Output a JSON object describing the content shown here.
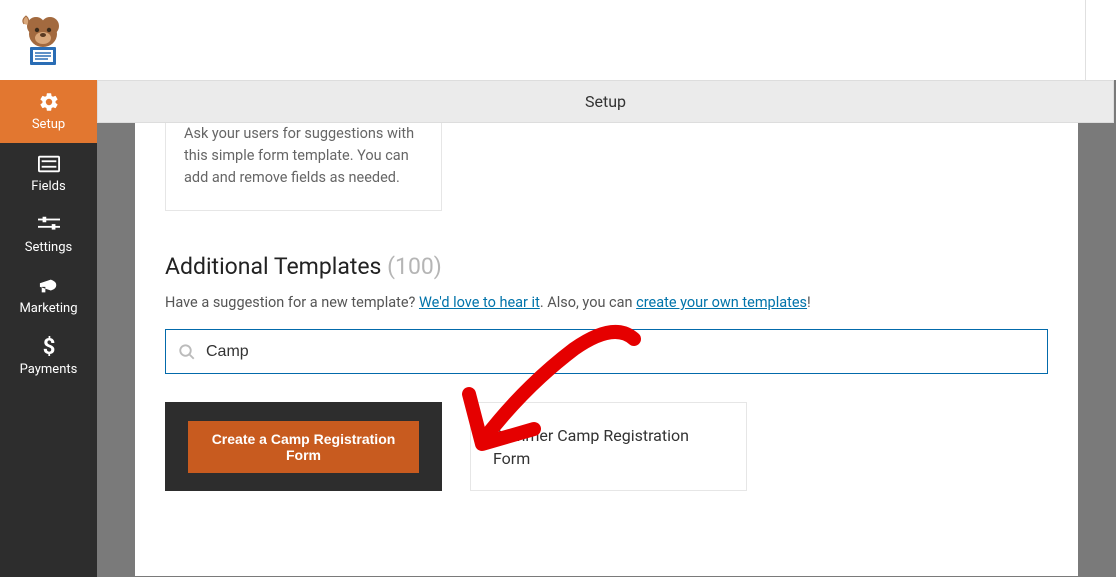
{
  "header": {
    "title": "Setup"
  },
  "sidebar": {
    "items": [
      {
        "label": "Setup",
        "icon": "gear-icon",
        "active": true
      },
      {
        "label": "Fields",
        "icon": "list-icon",
        "active": false
      },
      {
        "label": "Settings",
        "icon": "sliders-icon",
        "active": false
      },
      {
        "label": "Marketing",
        "icon": "bullhorn-icon",
        "active": false
      },
      {
        "label": "Payments",
        "icon": "dollar-icon",
        "active": false
      }
    ]
  },
  "suggestion_card": {
    "text": "Ask your users for suggestions with this simple form template. You can add and remove fields as needed."
  },
  "additional": {
    "title": "Additional Templates",
    "count": "(100)",
    "subtext_prefix": "Have a suggestion for a new template? ",
    "link1": "We'd love to hear it",
    "subtext_mid": ". Also, you can ",
    "link2": "create your own templates",
    "subtext_suffix": "!"
  },
  "search": {
    "value": "Camp",
    "placeholder": ""
  },
  "results": {
    "create_button": "Create a Camp Registration Form",
    "item1": "Summer Camp Registration Form"
  }
}
